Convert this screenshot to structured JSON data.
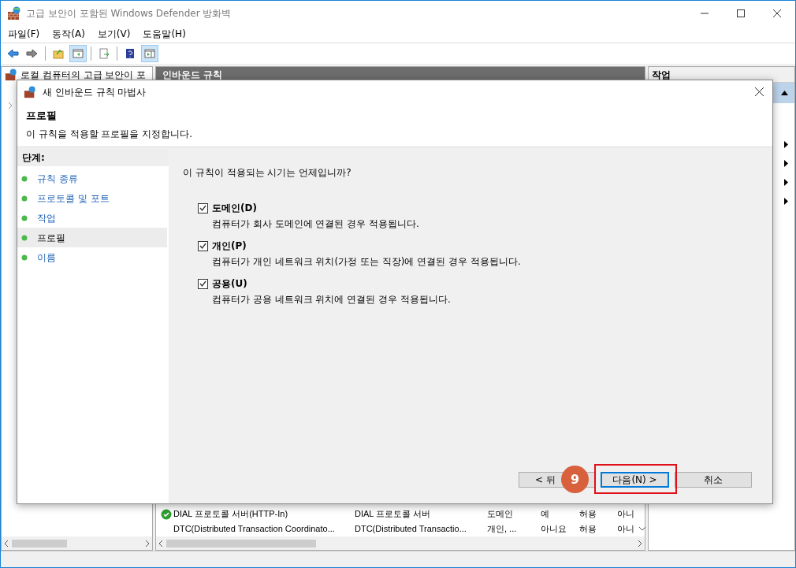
{
  "window": {
    "title": "고급 보안이 포함된 Windows Defender 방화벽"
  },
  "menu": [
    {
      "label": "파일(F)"
    },
    {
      "label": "동작(A)"
    },
    {
      "label": "보기(V)"
    },
    {
      "label": "도움말(H)"
    }
  ],
  "toolbar": [
    {
      "kind": "back",
      "selected": false
    },
    {
      "kind": "forward",
      "selected": false
    },
    {
      "kind": "up",
      "selected": false
    },
    {
      "kind": "tree",
      "selected": true
    },
    {
      "kind": "export",
      "selected": false
    },
    {
      "kind": "help",
      "selected": false
    },
    {
      "kind": "actions",
      "selected": true
    }
  ],
  "tree_pane": {
    "header": "로컬 컴퓨터의 고급 보안이 포"
  },
  "rules_pane": {
    "header": "인바운드 규칙",
    "rows": [
      {
        "enabled": true,
        "cells": [
          "DIAL 프로토콜 서버(HTTP-In)",
          "DIAL 프로토콜 서버",
          "도메인",
          "예",
          "허용",
          "아니"
        ]
      },
      {
        "enabled": false,
        "cells": [
          "DTC(Distributed Transaction Coordinato...",
          "DTC(Distributed Transactio...",
          "개인, ...",
          "아니요",
          "허용",
          "아니"
        ]
      }
    ]
  },
  "actions_pane": {
    "header": "작업"
  },
  "dialog": {
    "title": "새 인바운드 규칙 마법사",
    "heading": "프로필",
    "subtitle": "이 규칙을 적용할 프로필을 지정합니다.",
    "steps_header": "단계:",
    "steps": [
      {
        "label": "규칙 종류",
        "selected": false
      },
      {
        "label": "프로토콜 및 포트",
        "selected": false
      },
      {
        "label": "작업",
        "selected": false
      },
      {
        "label": "프로필",
        "selected": true
      },
      {
        "label": "이름",
        "selected": false
      }
    ],
    "question": "이 규칙이 적용되는 시기는 언제입니까?",
    "profiles": [
      {
        "label": "도메인(D)",
        "description": "컴퓨터가 회사 도메인에 연결된 경우 적용됩니다.",
        "checked": true
      },
      {
        "label": "개인(P)",
        "description": "컴퓨터가 개인 네트워크 위치(가정 또는 직장)에 연결된 경우 적용됩니다.",
        "checked": true
      },
      {
        "label": "공용(U)",
        "description": "컴퓨터가 공용 네트워크 위치에 연결된 경우 적용됩니다.",
        "checked": true
      }
    ],
    "buttons": [
      {
        "kind": "back",
        "label": "< 뒤"
      },
      {
        "kind": "next",
        "label": "다음(N) >"
      },
      {
        "kind": "cancel",
        "label": "취소"
      }
    ]
  },
  "annotation": {
    "badge": "9"
  }
}
